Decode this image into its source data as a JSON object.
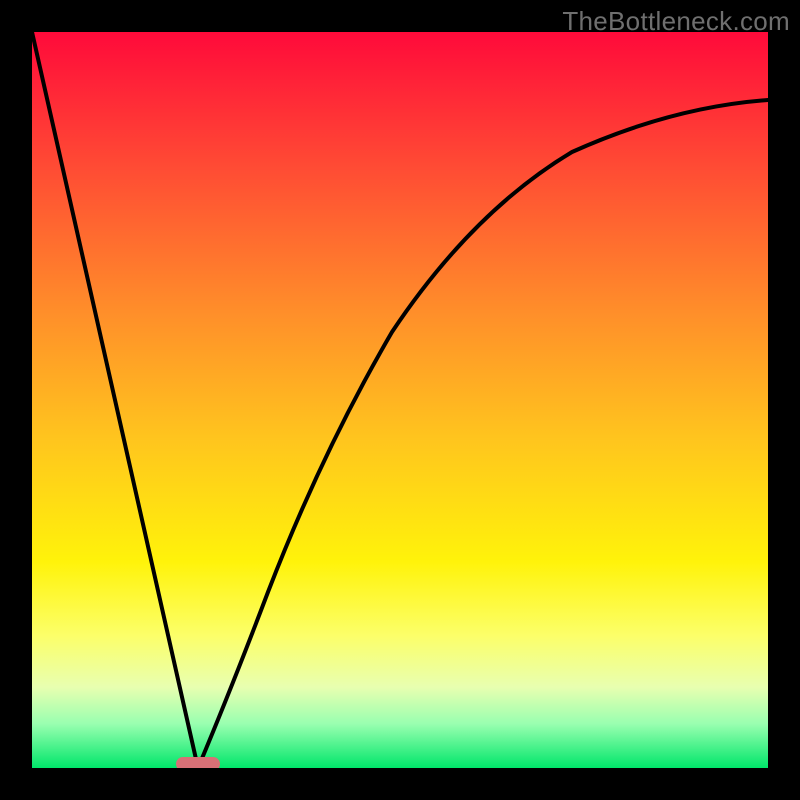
{
  "watermark": "TheBottleneck.com",
  "marker": {
    "x_frac": 0.225
  },
  "colors": {
    "curve": "#000000",
    "marker": "#d87076",
    "gradient_top": "#ff0a3a",
    "gradient_bottom": "#00e66a"
  },
  "chart_data": {
    "type": "line",
    "title": "",
    "xlabel": "",
    "ylabel": "",
    "xlim": [
      0,
      1
    ],
    "ylim": [
      0,
      100
    ],
    "series": [
      {
        "name": "left-branch",
        "x": [
          0.0,
          0.05,
          0.1,
          0.15,
          0.2,
          0.225
        ],
        "values": [
          100,
          78,
          56,
          34,
          11,
          0
        ]
      },
      {
        "name": "right-branch",
        "x": [
          0.225,
          0.27,
          0.32,
          0.38,
          0.45,
          0.53,
          0.62,
          0.72,
          0.83,
          0.92,
          1.0
        ],
        "values": [
          0,
          11,
          24,
          37,
          49,
          60,
          69,
          77,
          83,
          87,
          90
        ]
      }
    ],
    "annotations": [
      {
        "type": "marker",
        "x": 0.225,
        "y": 0,
        "label": ""
      }
    ]
  }
}
